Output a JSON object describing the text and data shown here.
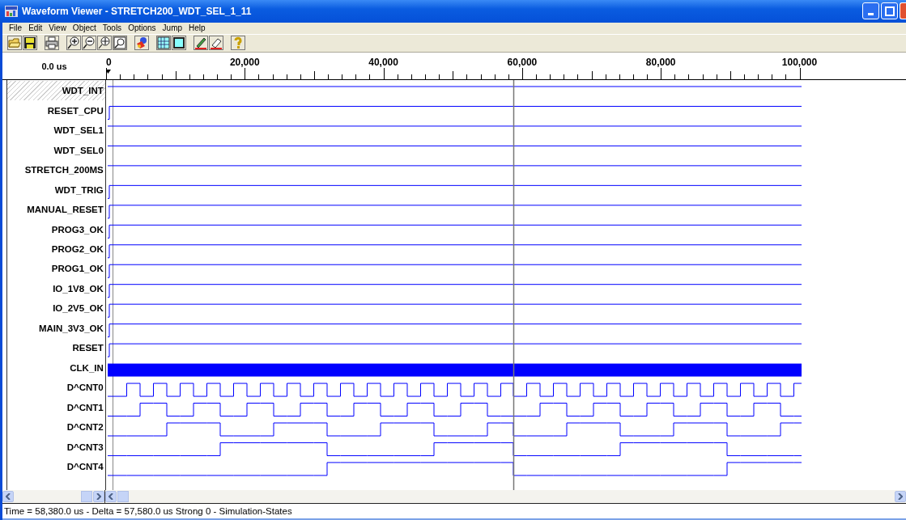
{
  "window": {
    "title": "Waveform Viewer - STRETCH200_WDT_SEL_1_11"
  },
  "menu": [
    {
      "label": "File"
    },
    {
      "label": "Edit"
    },
    {
      "label": "View"
    },
    {
      "label": "Object"
    },
    {
      "label": "Tools"
    },
    {
      "label": "Options"
    },
    {
      "label": "Jump"
    },
    {
      "label": "Help"
    }
  ],
  "time_display": "0.0 us",
  "ruler": {
    "labels": [
      "0",
      "20,000",
      "40,000",
      "60,000",
      "80,000",
      "100,000"
    ]
  },
  "signals": [
    {
      "name": "WDT_INT",
      "kind": "high",
      "selected": true
    },
    {
      "name": "RESET_CPU",
      "kind": "step",
      "selected": false
    },
    {
      "name": "WDT_SEL1",
      "kind": "high",
      "selected": false
    },
    {
      "name": "WDT_SEL0",
      "kind": "high",
      "selected": false
    },
    {
      "name": "STRETCH_200MS",
      "kind": "high",
      "selected": false
    },
    {
      "name": "WDT_TRIG",
      "kind": "step",
      "selected": false
    },
    {
      "name": "MANUAL_RESET",
      "kind": "step",
      "selected": false
    },
    {
      "name": "PROG3_OK",
      "kind": "step",
      "selected": false
    },
    {
      "name": "PROG2_OK",
      "kind": "step",
      "selected": false
    },
    {
      "name": "PROG1_OK",
      "kind": "step",
      "selected": false
    },
    {
      "name": "IO_1V8_OK",
      "kind": "step",
      "selected": false
    },
    {
      "name": "IO_2V5_OK",
      "kind": "step",
      "selected": false
    },
    {
      "name": "MAIN_3V3_OK",
      "kind": "step",
      "selected": false
    },
    {
      "name": "RESET",
      "kind": "step",
      "selected": false
    },
    {
      "name": "CLK_IN",
      "kind": "bus",
      "selected": false
    },
    {
      "name": "D^CNT0",
      "kind": "counter",
      "selected": false
    },
    {
      "name": "D^CNT1",
      "kind": "counter",
      "selected": false
    },
    {
      "name": "D^CNT2",
      "kind": "counter",
      "selected": false
    },
    {
      "name": "D^CNT3",
      "kind": "counter",
      "selected": false
    },
    {
      "name": "D^CNT4",
      "kind": "counter",
      "selected": false
    }
  ],
  "status_bar": "Time = 58,380.0 us - Delta = 57,580.0 us Strong 0 - Simulation-States"
}
